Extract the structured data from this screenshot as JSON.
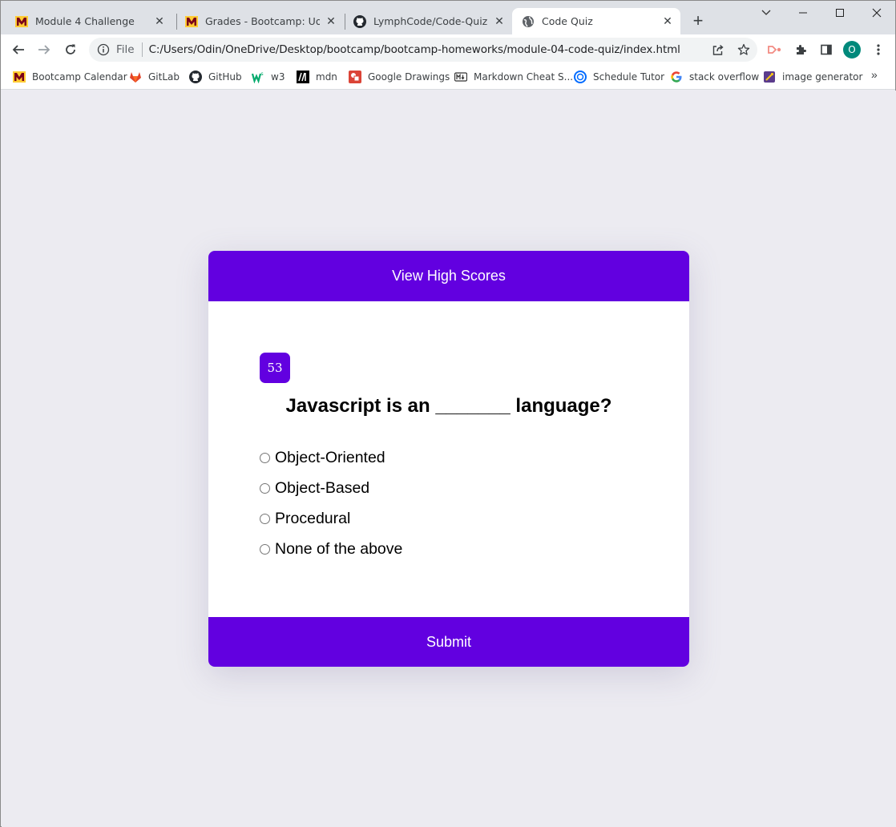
{
  "browser": {
    "tabs": [
      {
        "title": "Module 4 Challenge",
        "favicon": "umn-m-icon",
        "active": false
      },
      {
        "title": "Grades - Bootcamp: UofM-V",
        "favicon": "umn-m-icon",
        "active": false
      },
      {
        "title": "LymphCode/Code-Quiz",
        "favicon": "github-icon",
        "active": false
      },
      {
        "title": "Code Quiz",
        "favicon": "globe-icon",
        "active": true
      }
    ],
    "new_tab_label": "+",
    "address": {
      "scheme_label": "File",
      "url": "C:/Users/Odin/OneDrive/Desktop/bootcamp/bootcamp-homeworks/module-04-code-quiz/index.html"
    },
    "profile_initial": "O",
    "bookmarks": [
      {
        "label": "Bootcamp Calendar",
        "icon": "umn-m-icon"
      },
      {
        "label": "GitLab",
        "icon": "gitlab-icon"
      },
      {
        "label": "GitHub",
        "icon": "github-icon"
      },
      {
        "label": "w3",
        "icon": "w3-icon"
      },
      {
        "label": "mdn",
        "icon": "mdn-icon"
      },
      {
        "label": "Google Drawings",
        "icon": "google-drawings-icon"
      },
      {
        "label": "Markdown Cheat S...",
        "icon": "markdown-icon"
      },
      {
        "label": "Schedule Tutor",
        "icon": "calendly-icon"
      },
      {
        "label": "stack overflow",
        "icon": "google-icon"
      },
      {
        "label": "image generator",
        "icon": "image-generator-icon"
      }
    ],
    "bookmarks_more": "»"
  },
  "quiz": {
    "header_label": "View High Scores",
    "timer": "53",
    "question": "Javascript is an _______ language?",
    "options": [
      "Object-Oriented",
      "Object-Based",
      "Procedural",
      "None of the above"
    ],
    "submit_label": "Submit"
  },
  "colors": {
    "accent": "#6200e0",
    "page_background": "#ecebf1",
    "chrome_tabstrip": "#dee1e6"
  }
}
